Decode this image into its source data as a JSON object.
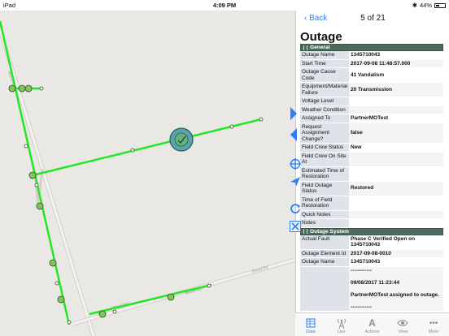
{
  "statusbar": {
    "carrier": "iPad",
    "time": "4:09 PM",
    "battery_text": "44%",
    "battery_level": 0.44
  },
  "map": {
    "road_labels": [
      "Wood Rd",
      "Wood Rd",
      "Wood Rd"
    ],
    "colors": {
      "line": "#22e822",
      "node_fill": "#7fc75a",
      "selected_fill": "#56a5a8",
      "road": "#cfcdc9"
    }
  },
  "panel": {
    "back_label": "Back",
    "pager": "5 of 21",
    "title": "Outage",
    "sections": [
      {
        "name": "General",
        "rows": [
          {
            "key": "Outage Name",
            "value": "1345710043"
          },
          {
            "key": "Start Time",
            "value": "2017-09-08 11:48:57.000"
          },
          {
            "key": "Outage Cause Code",
            "value": "41 Vandalism"
          },
          {
            "key": "Equipment/Material Failure",
            "value": "20 Transmission"
          },
          {
            "key": "Voltage Level",
            "value": ""
          },
          {
            "key": "Weather Condition",
            "value": ""
          },
          {
            "key": "Assigned To",
            "value": "PartnerMOTest"
          },
          {
            "key": "Request Assignment Change?",
            "value": "false"
          },
          {
            "key": "Field Crew Status",
            "value": "New"
          },
          {
            "key": "Field Crew On Site At",
            "value": ""
          },
          {
            "key": "Estimated Time of Restoration",
            "value": ""
          },
          {
            "key": "Field Outage Status",
            "value": "Restored"
          },
          {
            "key": "Time of Field Restoration",
            "value": ""
          },
          {
            "key": "Quick Notes",
            "value": ""
          },
          {
            "key": "Notes",
            "value": ""
          }
        ]
      },
      {
        "name": "Outage System",
        "rows": [
          {
            "key": "Actual Fault",
            "value": "Phase C Verified Open on 1345710043"
          },
          {
            "key": "Outage Element Id",
            "value": "2017-09-08-0010"
          },
          {
            "key": "Outage Name",
            "value": "1345710043"
          },
          {
            "key": "",
            "value": "------------\n\n09/08/2017 11:23:44\n\nPartnerMOTest assigned to outage.\n\n------------"
          }
        ]
      }
    ]
  },
  "tabs": [
    {
      "label": "Data",
      "icon": "data-icon",
      "active": true
    },
    {
      "label": "Live",
      "icon": "live-icon",
      "active": false
    },
    {
      "label": "Actions",
      "icon": "actions-icon",
      "active": false
    },
    {
      "label": "View",
      "icon": "view-icon",
      "active": false
    },
    {
      "label": "More",
      "icon": "more-icon",
      "active": false
    }
  ]
}
